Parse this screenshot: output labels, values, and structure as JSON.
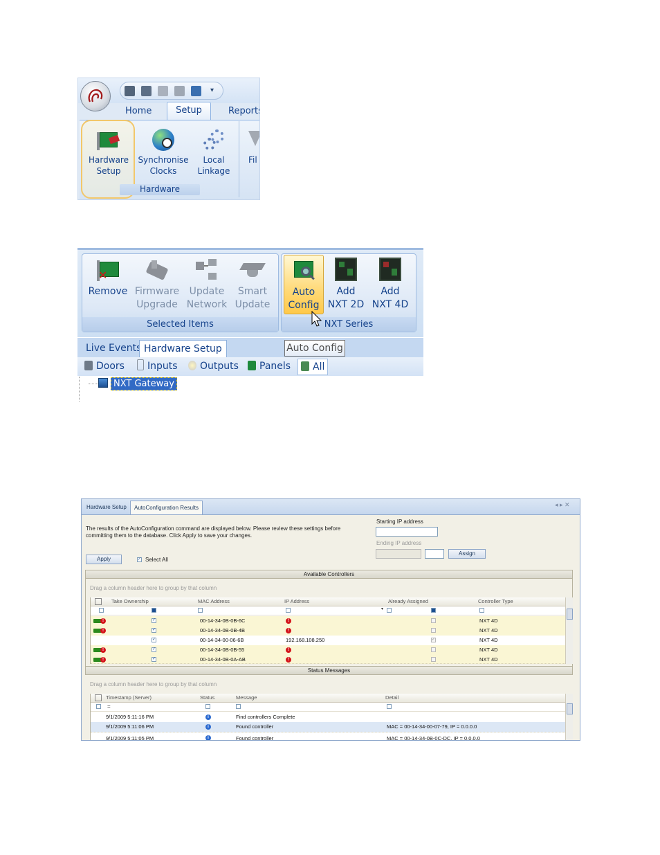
{
  "shot1": {
    "tabs": [
      "Home",
      "Setup",
      "Reports"
    ],
    "buttons": [
      {
        "label_line1": "Hardware",
        "label_line2": "Setup",
        "icon": "hardware-card-icon"
      },
      {
        "label_line1": "Synchronise",
        "label_line2": "Clocks",
        "icon": "globe-clock-icon"
      },
      {
        "label_line1": "Local",
        "label_line2": "Linkage",
        "icon": "gears-icon"
      },
      {
        "label_line1": "Fil",
        "label_line2": "",
        "icon": "filter-icon"
      }
    ],
    "group_label": "Hardware",
    "qat_icons": [
      "save-icon",
      "save-all-icon",
      "print-preview-icon",
      "print-icon",
      "monitor-icon",
      "dropdown-icon"
    ]
  },
  "shot2": {
    "selected_items": {
      "label": "Selected Items",
      "buttons": [
        {
          "line1": "Remove",
          "line2": "",
          "icon": "remove-card-icon"
        },
        {
          "line1": "Firmware",
          "line2": "Upgrade",
          "icon": "firmware-chip-icon"
        },
        {
          "line1": "Update",
          "line2": "Network",
          "icon": "network-icon"
        },
        {
          "line1": "Smart",
          "line2": "Update",
          "icon": "graduation-cap-icon"
        }
      ]
    },
    "nxt_series": {
      "label": "NXT Series",
      "buttons": [
        {
          "line1": "Auto",
          "line2": "Config",
          "icon": "auto-config-icon"
        },
        {
          "line1": "Add",
          "line2": "NXT 2D",
          "icon": "circuit-board-icon"
        },
        {
          "line1": "Add",
          "line2": "NXT 4D",
          "icon": "circuit-board-icon"
        }
      ]
    },
    "tabs": [
      "Live Events",
      "Hardware Setup"
    ],
    "tooltip": "Auto Config",
    "filters": [
      "Doors",
      "Inputs",
      "Outputs",
      "Panels",
      "All"
    ],
    "tree_node": "NXT Gateway"
  },
  "shot3": {
    "doc_tabs": [
      "Hardware Setup",
      "AutoConfiguration Results"
    ],
    "window_controls": "◂ ▸ ✕",
    "description_line1": "The results of the AutoConfiguration command are displayed below.  Please review these settings before",
    "description_line2": "committing them to the database.  Click Apply to save your changes.",
    "starting_ip_label": "Starting IP address",
    "ending_ip_label": "Ending IP address",
    "assign_label": "Assign",
    "apply_label": "Apply",
    "select_all_label": "Select All",
    "available_controllers_title": "Available Controllers",
    "drag_hint": "Drag a column header here to group by that column",
    "controller_columns": [
      "Take Ownership",
      "MAC Address",
      "IP Address",
      "Already Assigned",
      "Controller Type"
    ],
    "controllers": [
      {
        "mac": "00-14-34-0B-0B-6C",
        "ip": "",
        "ip_error": true,
        "assigned": false,
        "type": "NXT 4D",
        "row_error": true
      },
      {
        "mac": "00-14-34-0B-0B-4B",
        "ip": "",
        "ip_error": true,
        "assigned": false,
        "type": "NXT 4D",
        "row_error": true
      },
      {
        "mac": "00-14-34-00-06-6B",
        "ip": "192.168.108.250",
        "ip_error": false,
        "assigned": true,
        "type": "NXT 4D",
        "row_error": false
      },
      {
        "mac": "00-14-34-0B-0B-55",
        "ip": "",
        "ip_error": true,
        "assigned": false,
        "type": "NXT 4D",
        "row_error": true
      },
      {
        "mac": "00-14-34-0B-0A-AB",
        "ip": "",
        "ip_error": true,
        "assigned": false,
        "type": "NXT 4D",
        "row_error": true
      }
    ],
    "status_messages_title": "Status Messages",
    "status_columns": [
      "Timestamp (Server)",
      "Status",
      "Message",
      "Detail"
    ],
    "status_filter_op": "=",
    "status_rows": [
      {
        "timestamp": "9/1/2009 5:11:16 PM",
        "message": "Find controllers Complete",
        "detail": ""
      },
      {
        "timestamp": "9/1/2009 5:11:06 PM",
        "message": "Found controller",
        "detail": "MAC = 00-14-34-00-07-79, IP = 0.0.0.0"
      },
      {
        "timestamp": "9/1/2009 5:11:05 PM",
        "message": "Found controller",
        "detail": "MAC = 00-14-34-0B-0C-DC, IP = 0.0.0.0"
      }
    ]
  }
}
